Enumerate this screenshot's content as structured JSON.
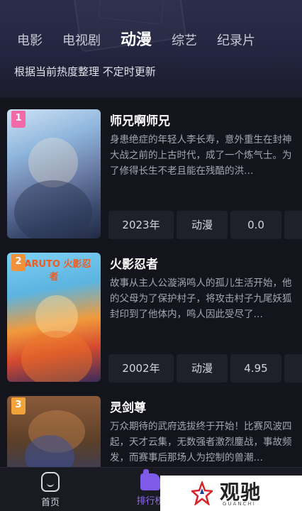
{
  "tabs": [
    {
      "label": "电影",
      "active": false
    },
    {
      "label": "电视剧",
      "active": false
    },
    {
      "label": "动漫",
      "active": true
    },
    {
      "label": "综艺",
      "active": false
    },
    {
      "label": "纪录片",
      "active": false
    }
  ],
  "subtitle": "根据当前热度整理 不定时更新",
  "items": [
    {
      "rank": "1",
      "title": "师兄啊师兄",
      "desc": "身患绝症的年轻人李长寿，意外重生在封神大战之前的上古时代，成了一个炼气士。为了修得长生不老且能在残酷的洪…",
      "year": "2023年",
      "genre": "动漫",
      "score": "0.0"
    },
    {
      "rank": "2",
      "title": "火影忍者",
      "desc": "故事从主人公漩涡鸣人的孤儿生活开始，他的父母为了保护村子，将攻击村子九尾妖狐封印到了他体内，鸣人因此受尽了…",
      "year": "2002年",
      "genre": "动漫",
      "score": "4.95",
      "poster_text": "NARUTO 火影忍者"
    },
    {
      "rank": "3",
      "title": "灵剑尊",
      "desc": "万众期待的武府选拔终于开始！比赛风波四起，天才云集，无数强者激烈鏖战，事故频发，而赛事后那场人为控制的兽潮…"
    }
  ],
  "nav": {
    "home_label": "首页",
    "rank_label": "排行榜"
  },
  "watermark": {
    "text": "观驰",
    "sub": "GUANCHI"
  },
  "colors": {
    "accent": "#7d5be8",
    "rank1": "#f06aa8",
    "rank2": "#f2913a",
    "rank3": "#f2a33a"
  },
  "icons": [
    "home-icon",
    "rank-icon"
  ]
}
